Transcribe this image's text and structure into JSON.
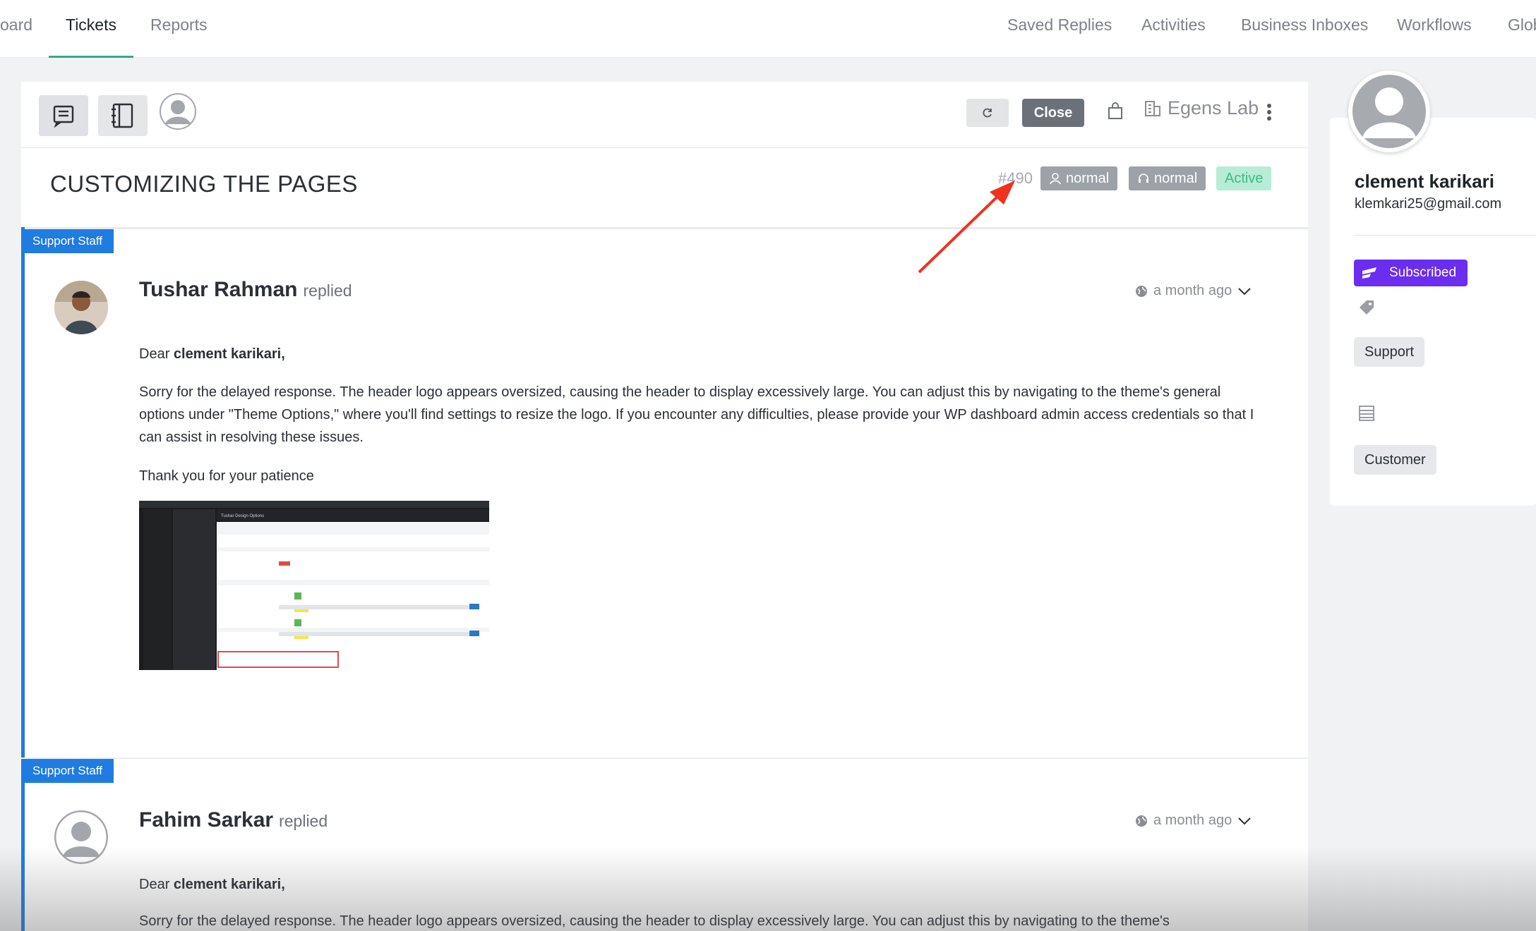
{
  "topnav": {
    "items": [
      "oard",
      "Tickets",
      "Reports",
      "Saved Replies",
      "Activities",
      "Business Inboxes",
      "Workflows",
      "Glob"
    ],
    "active": "Tickets"
  },
  "toolbar": {
    "close_label": "Close",
    "inbox_name": "Egens Lab"
  },
  "ticket": {
    "subject": "CUSTOMIZING THE PAGES",
    "id": "#490",
    "priority_customer": "normal",
    "priority_agent": "normal",
    "status": "Active"
  },
  "replies": [
    {
      "tag": "Support Staff",
      "author": "Tushar Rahman",
      "action": "replied",
      "time": "a month ago",
      "greeting_prefix": "Dear ",
      "greeting_name": "clement karikari,",
      "paragraph": "Sorry for the delayed response. The header logo appears oversized, causing the header to display excessively large. You can adjust this by navigating to the theme's general options under \"Theme Options,\" where you'll find settings to resize the logo. If you encounter any difficulties, please provide your WP dashboard admin access credentials so that I can assist in resolving these issues.",
      "closing": "Thank you for your patience",
      "attachment_title": "Tushar Design Options"
    },
    {
      "tag": "Support Staff",
      "author": "Fahim Sarkar",
      "action": "replied",
      "time": "a month ago",
      "greeting_prefix": "Dear ",
      "greeting_name": "clement karikari,",
      "paragraph": "Sorry for the delayed response. The header logo appears oversized, causing the header to display excessively large. You can adjust this by navigating to the theme's"
    }
  ],
  "customer": {
    "name": "clement karikari",
    "email": "klemkari25@gmail.com",
    "subscription": "Subscribed",
    "tags": [
      "Support"
    ],
    "lists": [
      "Customer"
    ]
  },
  "colors": {
    "accent": "#37a889",
    "staff_tag": "#1f7ce0",
    "subscribed": "#6b2df0",
    "active_badge_bg": "#b7ecd7",
    "annotation_arrow": "#f0321f"
  }
}
